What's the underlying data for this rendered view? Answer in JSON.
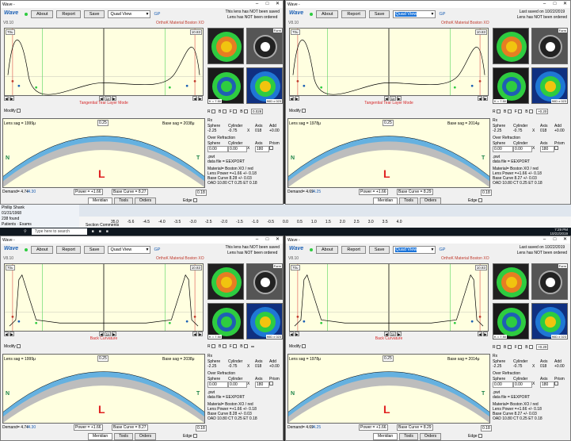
{
  "app": {
    "title": "Wave -",
    "logo": "Wave",
    "about": "About",
    "report": "Report",
    "save": "Save",
    "view_select": "Quad View",
    "gp": "GP",
    "version": "V8.10",
    "material": "OrthoK Material   Boston XO",
    "not_saved": "This lens has NOT been saved",
    "not_ordered": "Lens has NOT been ordered",
    "last_saved": "Last saved on 10/22/2019"
  },
  "panels": [
    {
      "status_line1": "This lens has NOT been saved",
      "status_line2": "Lens has NOT been ordered",
      "mode_label": "Tangential Tear Layer Mode",
      "left_box": "70u",
      "right_box": "10.83",
      "zoom": "1x",
      "lens_sag": "Lens sag = 1999μ",
      "base_sag": "Base sag = 2038μ",
      "mid": "0.25",
      "edge_val": "0.18",
      "demand": "Demand= 4.74",
      "demand_axis": "/4.30",
      "power": "Power = +1.66",
      "base_curve": "Base Curve = 8.27",
      "map_k": "K = 7.50",
      "map_b": "90D x 023",
      "map_form": "Form",
      "b_val": "0.028",
      "rx_header": "Rx",
      "rx_cols": [
        "Sphere",
        "Cylinder",
        "Axis",
        "Add"
      ],
      "rx_vals": [
        "-2.25",
        "-0.75",
        "018",
        "+0.00"
      ],
      "over_header": "Over Refraction",
      "over_cols": [
        "Sphere",
        "Cylinder",
        "Axis",
        "Prism"
      ],
      "over_vals": [
        "0.00",
        "0.00",
        "180",
        ""
      ],
      "pwt": ".pwt",
      "data_file": "data file = EEXPORT",
      "mat_line": "Material= Boston XO / red",
      "lens_power": "Lens Power =+1.66 +/- 0.18",
      "base_curve_line": "Base Curve 8.28 +/- 0.03",
      "oad": "OAD 10.80 CT 0.25 ET 0.18"
    },
    {
      "status_line1": "Last saved on 10/22/2019",
      "status_line2": "Lens has NOT been ordered",
      "mode_label": "Tangential Tear Layer Mode",
      "left_box": "70u",
      "right_box": "10.83",
      "zoom": "1x",
      "lens_sag": "Lens sag = 1978μ",
      "base_sag": "Base sag = 2014μ",
      "mid": "0.25",
      "edge_val": "0.18",
      "demand": "Demand= 4.69",
      "demand_axis": "/4.25",
      "power": "Power = +1.66",
      "base_curve": "Base Curve = 8.29",
      "map_k": "K = 7.50",
      "map_b": "90D x 023",
      "map_form": "Form",
      "b_val": "+0.20",
      "rx_header": "Rx",
      "rx_cols": [
        "Sphere",
        "Cylinder",
        "Axis",
        "Add"
      ],
      "rx_vals": [
        "-2.25",
        "-0.75",
        "018",
        "+0.00"
      ],
      "over_header": "Over Refraction",
      "over_cols": [
        "Sphere",
        "Cylinder",
        "Axis",
        "Prism"
      ],
      "over_vals": [
        "0.00",
        "0.00",
        "180",
        ""
      ],
      "pwt": ".pwt",
      "data_file": "data file = EEXPORT",
      "mat_line": "Material= Boston XO / red",
      "lens_power": "Lens Power =+1.66 +/- 0.18",
      "base_curve_line": "Base Curve 8.27 +/- 0.03",
      "oad": "OAD 10.80 CT 0.25 ET 0.18"
    },
    {
      "status_line1": "This lens has NOT been saved",
      "status_line2": "Lens has NOT been ordered",
      "mode_label": "Back Curvature",
      "left_box": "70u",
      "right_box": "10.83",
      "zoom": "1x",
      "lens_sag": "Lens sag = 1999μ",
      "base_sag": "Base sag = 2038μ",
      "mid": "0.25",
      "edge_val": "0.18",
      "demand": "Demand= 4.74",
      "demand_axis": "/4.30",
      "power": "Power = +1.66",
      "base_curve": "Base Curve = 8.27",
      "map_k": "K = 7.50",
      "map_b": "90D x 023",
      "map_form": "Form",
      "b_val": "",
      "rx_header": "Rx",
      "rx_cols": [
        "Sphere",
        "Cylinder",
        "Axis",
        "Add"
      ],
      "rx_vals": [
        "-2.25",
        "-0.75",
        "018",
        "+0.00"
      ],
      "over_header": "Over Refraction",
      "over_cols": [
        "Sphere",
        "Cylinder",
        "Axis",
        "Prism"
      ],
      "over_vals": [
        "0.00",
        "0.00",
        "180",
        ""
      ],
      "pwt": ".pwt",
      "data_file": "data file = EEXPORT",
      "mat_line": "Material= Boston XO / red",
      "lens_power": "Lens Power =+1.66 +/- 0.18",
      "base_curve_line": "Base Curve 8.28 +/- 0.03",
      "oad": "OAD 10.80 CT 0.25 ET 0.18"
    },
    {
      "status_line1": "Last saved on 10/22/2019",
      "status_line2": "Lens has NOT been ordered",
      "mode_label": "Back Curvature",
      "left_box": "70u",
      "right_box": "10.83",
      "zoom": "1x",
      "lens_sag": "Lens sag = 1978μ",
      "base_sag": "Base sag = 2014μ",
      "mid": "0.25",
      "edge_val": "0.18",
      "demand": "Demand= 4.69",
      "demand_axis": "/4.25",
      "power": "Power = +1.66",
      "base_curve": "Base Curve = 8.29",
      "map_k": "K = 7.50",
      "map_b": "90D x 023",
      "map_form": "Form",
      "b_val": "+0.20",
      "rx_header": "Rx",
      "rx_cols": [
        "Sphere",
        "Cylinder",
        "Axis",
        "Add"
      ],
      "rx_vals": [
        "-2.25",
        "-0.75",
        "018",
        "+0.00"
      ],
      "over_header": "Over Refraction",
      "over_cols": [
        "Sphere",
        "Cylinder",
        "Axis",
        "Prism"
      ],
      "over_vals": [
        "0.00",
        "0.00",
        "180",
        ""
      ],
      "pwt": ".pwt",
      "data_file": "data file = EEXPORT",
      "mat_line": "Material= Boston XO / red",
      "lens_power": "Lens Power =+1.66 +/- 0.18",
      "base_curve_line": "Base Curve 8.27 +/- 0.03",
      "oad": "OAD 10.80 CT 0.25 ET 0.18"
    }
  ],
  "labels": {
    "modify": "Modify",
    "nasal": "N",
    "temporal": "T",
    "eye": "L",
    "edge": "Edge",
    "meridian": "Meridian",
    "tools": "Tools",
    "orders": "Orders",
    "r": "R",
    "b": "B",
    "f": "F",
    "b2": "B"
  },
  "background": {
    "scale_ticks": [
      "-5.6",
      "-4.5",
      "-4.0",
      "-3.5",
      "-3.0",
      "-2.5",
      "-2.0",
      "-1.5",
      "-1.0",
      "-0.5",
      "0.0",
      "0.5",
      "1.0",
      "1.5",
      "2.0",
      "2.5",
      "3.0",
      "3.5",
      "4.0"
    ],
    "section": "Section",
    "comments": "Comments",
    "search": "Type here to search",
    "patients_tab": "Patients",
    "exams_tab": "Exams",
    "found": "238 found",
    "pt_name": "Phillip Shank",
    "pt_date": "01/31/1968",
    "clock_time": "7:29 PM",
    "clock_date": "10/22/2019",
    "scale_left": "35.0"
  },
  "colors": {
    "graph_bg": "#ffffe0",
    "curve": "#000000",
    "blue_arc": "#4aa3df",
    "accent_red": "#d62728",
    "side_green": "#1e8449"
  }
}
